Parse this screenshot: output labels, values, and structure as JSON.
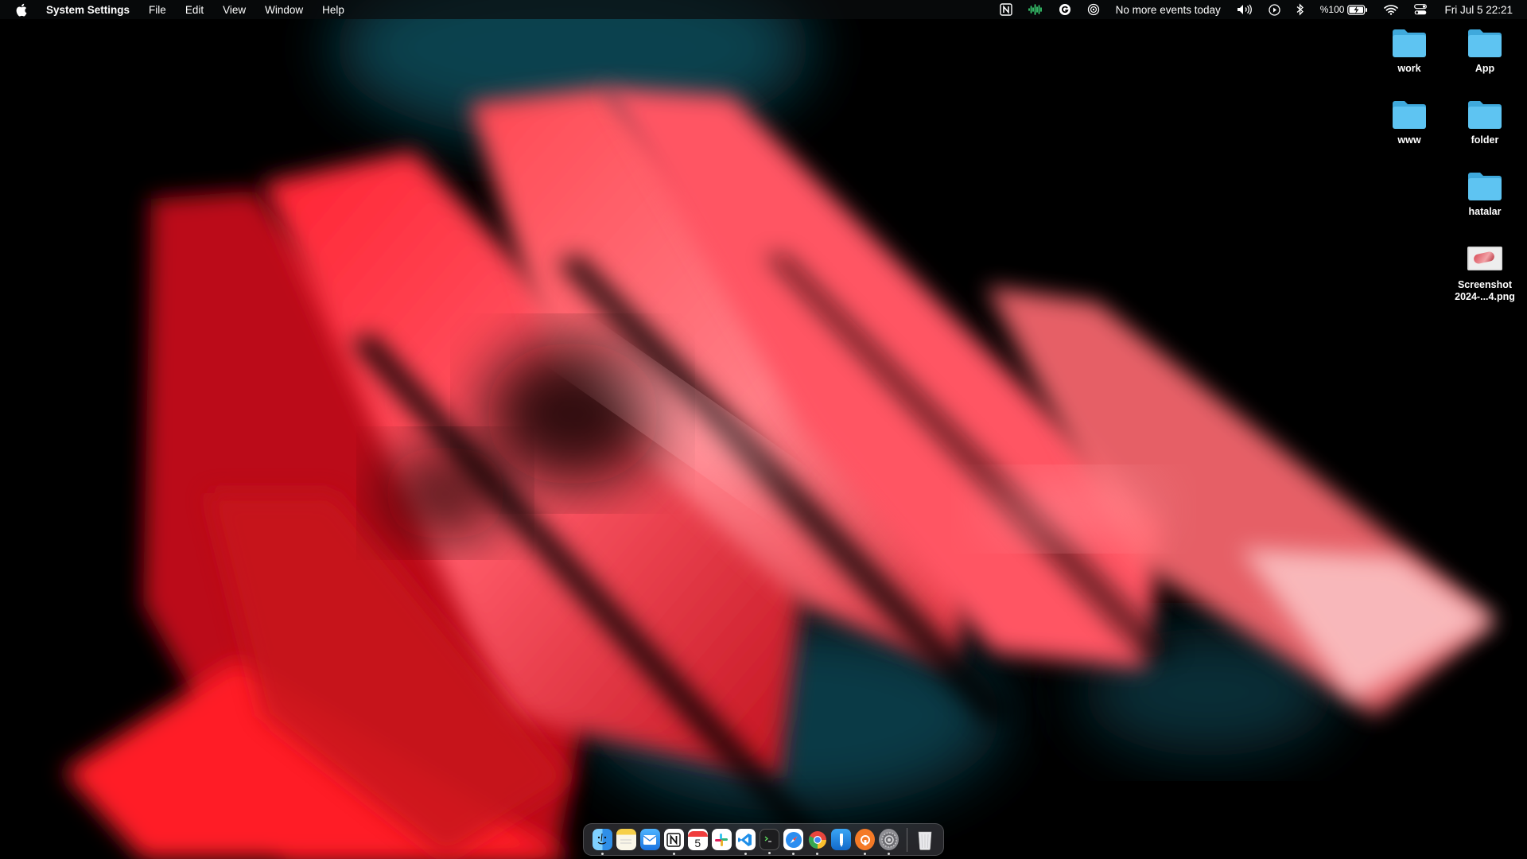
{
  "menubar": {
    "app_name": "System Settings",
    "menus": [
      "File",
      "Edit",
      "View",
      "Window",
      "Help"
    ],
    "calendar_status": "No more events today",
    "battery": "%100",
    "clock": "Fri Jul 5  22:21",
    "status_icons": [
      "notion-icon",
      "audio-waveform-icon",
      "grammarly-icon",
      "focus-icon",
      "volume-icon",
      "play-icon",
      "bluetooth-icon",
      "battery-icon",
      "wifi-icon",
      "control-center-icon"
    ]
  },
  "desktop": {
    "items": [
      {
        "name": "work",
        "type": "folder"
      },
      {
        "name": "App",
        "type": "folder"
      },
      {
        "name": "www",
        "type": "folder"
      },
      {
        "name": "folder",
        "type": "folder"
      },
      {
        "name": "hatalar",
        "type": "folder"
      },
      {
        "name": "Screenshot\n2024-...4.png",
        "type": "image"
      }
    ]
  },
  "dock": {
    "apps": [
      {
        "name": "Finder",
        "icon": "finder-icon",
        "running": true
      },
      {
        "name": "Notes",
        "icon": "notes-icon",
        "running": false
      },
      {
        "name": "Mail",
        "icon": "mail-icon",
        "running": false
      },
      {
        "name": "Notion",
        "icon": "notion-icon",
        "running": true
      },
      {
        "name": "Calendar",
        "icon": "calendar-icon",
        "running": false,
        "badge": "5"
      },
      {
        "name": "Slack",
        "icon": "slack-icon",
        "running": false
      },
      {
        "name": "Visual Studio Code",
        "icon": "vscode-icon",
        "running": true
      },
      {
        "name": "Terminal",
        "icon": "terminal-icon",
        "running": true
      },
      {
        "name": "Safari",
        "icon": "safari-icon",
        "running": true
      },
      {
        "name": "Chrome",
        "icon": "chrome-icon",
        "running": true
      },
      {
        "name": "Xcode-like Tool",
        "icon": "tool-icon",
        "running": false
      },
      {
        "name": "Orange App",
        "icon": "orange-app-icon",
        "running": true
      },
      {
        "name": "System Settings",
        "icon": "gear-icon",
        "running": true
      }
    ],
    "trash": {
      "name": "Trash",
      "icon": "trash-icon"
    }
  },
  "colors": {
    "folder": "#5ec4f2",
    "wall_red": "#ff2535",
    "wall_teal": "#0d4a58"
  }
}
